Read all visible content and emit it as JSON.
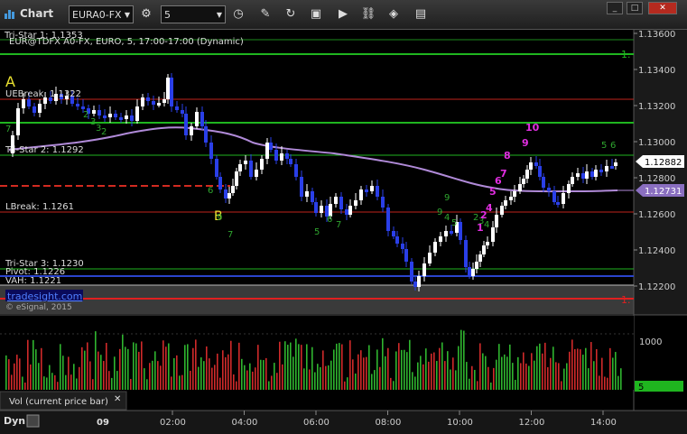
{
  "window": {
    "title": "Chart",
    "symbol": "EURA0-FX",
    "interval": "5",
    "min_label": "_",
    "max_label": "□",
    "close_label": "✕"
  },
  "chart": {
    "header": "EUR@TDFX A0-FX, EURO, 5, 17:00-17:00 (Dynamic)",
    "levels": {
      "tristar1": "Tri-Star 1: 1.1353",
      "uebreak": "UEBreak: 1.1322",
      "tristar2": "Tri-Star 2: 1.1292",
      "lbreak": "LBreak: 1.1261",
      "tristar3": "Tri-Star 3: 1.1230",
      "pivot": "Pivot: 1.1226",
      "vah": "VAH: 1.1221"
    },
    "marker_a": "A",
    "marker_b": "B",
    "watermark": "tradesight.com",
    "copyright": "© eSignal, 2015",
    "price_ticks": [
      "1.13600",
      "1.13400",
      "1.13200",
      "1.13000",
      "1.12800",
      "1.12600",
      "1.12400",
      "1.12200"
    ],
    "price_tags": {
      "last": "1.12882",
      "ma": "1.12731"
    },
    "green_price_label": "1.",
    "red_price_label": "1.",
    "green_seq": [
      "7",
      "2",
      "3",
      "3",
      "2",
      "6",
      "9",
      "7",
      "9",
      "5",
      "6",
      "7",
      "9",
      "4",
      "5",
      "2",
      "3",
      "4",
      "5",
      "6"
    ],
    "magenta_seq": [
      "1",
      "2",
      "4",
      "5",
      "6",
      "7",
      "8",
      "9",
      "10"
    ]
  },
  "volume": {
    "tick_label": "1000",
    "last_value": "5",
    "label": "Vol (current price bar)",
    "close_label": "✕"
  },
  "time_axis": {
    "mode_label": "Dyn",
    "date_label": "09",
    "ticks": [
      "02:00",
      "04:00",
      "06:00",
      "08:00",
      "10:00",
      "12:00",
      "14:00"
    ]
  }
}
